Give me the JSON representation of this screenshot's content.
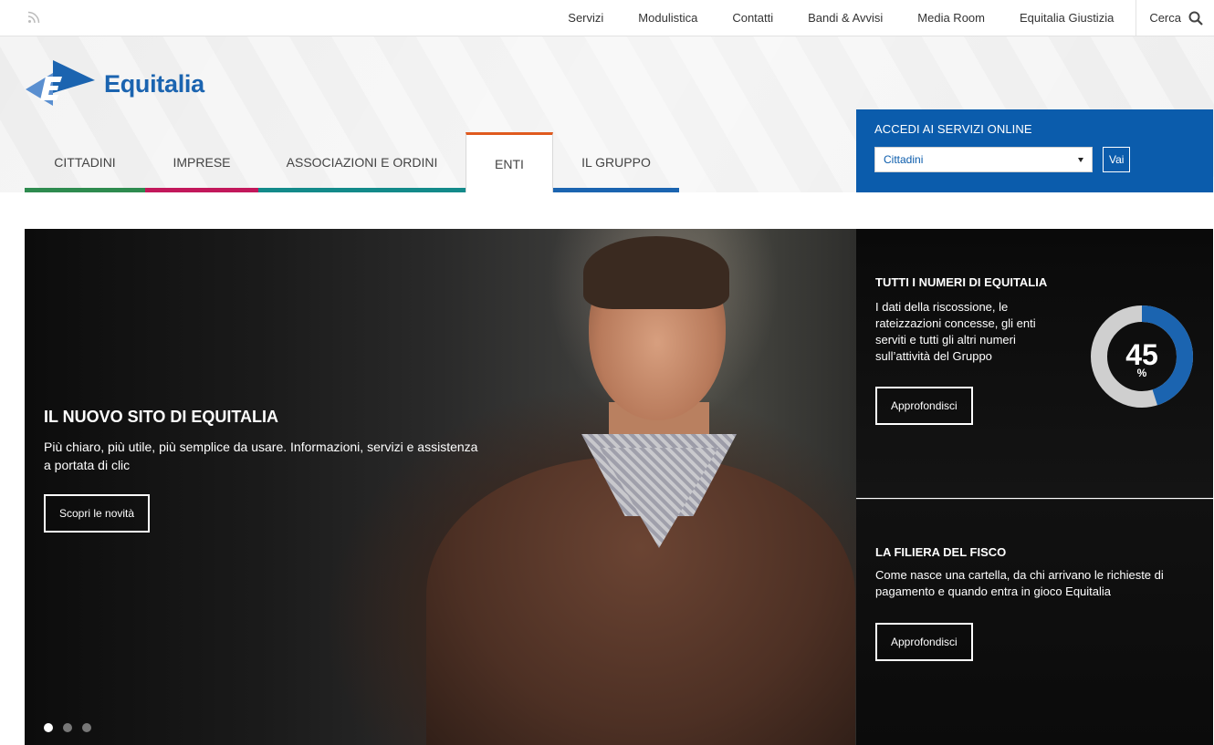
{
  "topbar": {
    "links": [
      "Servizi",
      "Modulistica",
      "Contatti",
      "Bandi & Avvisi",
      "Media Room",
      "Equitalia Giustizia"
    ],
    "search_label": "Cerca"
  },
  "logo": {
    "text": "Equitalia"
  },
  "nav": {
    "items": [
      {
        "label": "CITTADINI",
        "color": "#2e8b4f"
      },
      {
        "label": "IMPRESE",
        "color": "#c2185b"
      },
      {
        "label": "ASSOCIAZIONI E ORDINI",
        "color": "#138a8a"
      },
      {
        "label": "ENTI",
        "color": "#e05a1f"
      },
      {
        "label": "IL GRUPPO",
        "color": "#1b64b0"
      }
    ],
    "active": "ENTI"
  },
  "services": {
    "title": "ACCEDI AI SERVIZI ONLINE",
    "selected": "Cittadini",
    "go_label": "Vai"
  },
  "hero": {
    "title": "IL NUOVO SITO DI EQUITALIA",
    "desc": "Più chiaro, più utile, più semplice da usare. Informazioni, servizi e assistenza a portata di clic",
    "button": "Scopri le novità",
    "slides": 3,
    "active_slide": 1
  },
  "panel_numbers": {
    "title": "TUTTI I NUMERI DI EQUITALIA",
    "desc": "I dati della riscossione, le rateizzazioni concesse, gli enti serviti e tutti gli altri numeri sull’attività del Gruppo",
    "button": "Approfondisci",
    "gauge_value": "45",
    "gauge_unit": "%",
    "gauge_fraction": 0.45
  },
  "panel_filiera": {
    "title": "LA FILIERA DEL FISCO",
    "desc": "Come nasce una cartella, da chi arrivano le richieste di pagamento e quando entra in gioco Equitalia",
    "button": "Approfondisci"
  },
  "colors": {
    "brand": "#1b64b0",
    "services_bg": "#0b5cac",
    "active_tab": "#e05a1f"
  }
}
